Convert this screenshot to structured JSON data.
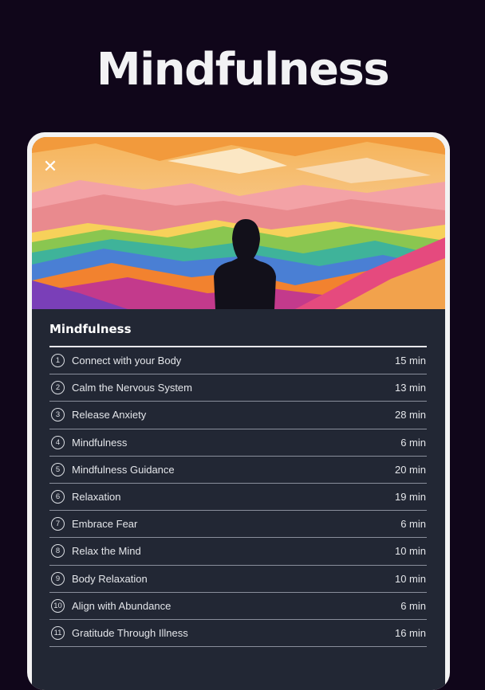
{
  "page": {
    "title": "Mindfulness"
  },
  "card": {
    "close_icon": "close-icon",
    "list_title": "Mindfulness",
    "items": [
      {
        "number": "1",
        "title": "Connect with your Body",
        "duration": "15 min"
      },
      {
        "number": "2",
        "title": "Calm the Nervous System",
        "duration": "13 min"
      },
      {
        "number": "3",
        "title": "Release Anxiety",
        "duration": "28 min"
      },
      {
        "number": "4",
        "title": "Mindfulness",
        "duration": "6 min"
      },
      {
        "number": "5",
        "title": "Mindfulness Guidance",
        "duration": "20 min"
      },
      {
        "number": "6",
        "title": "Relaxation",
        "duration": "19 min"
      },
      {
        "number": "7",
        "title": "Embrace Fear",
        "duration": "6 min"
      },
      {
        "number": "8",
        "title": "Relax the Mind",
        "duration": "10 min"
      },
      {
        "number": "9",
        "title": "Body Relaxation",
        "duration": "10 min"
      },
      {
        "number": "10",
        "title": "Align with Abundance",
        "duration": "6 min"
      },
      {
        "number": "11",
        "title": "Gratitude Through Illness",
        "duration": "16 min"
      }
    ]
  },
  "colors": {
    "background": "#10061a",
    "card": "#222734",
    "border": "#f3f3f3"
  }
}
